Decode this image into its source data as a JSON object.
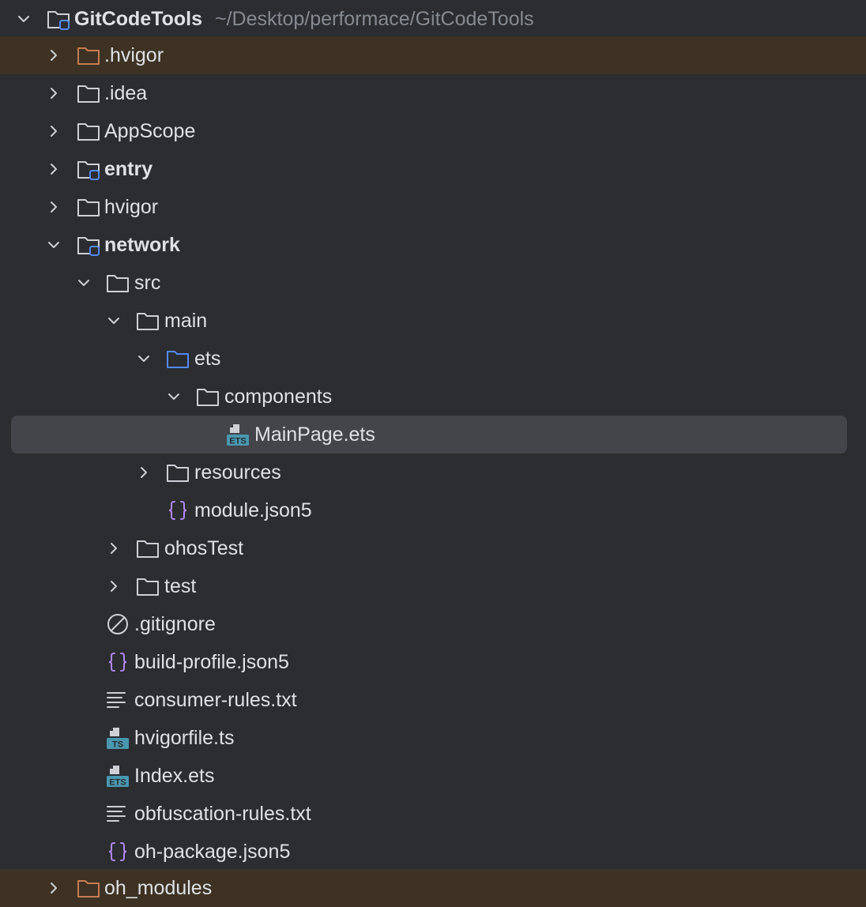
{
  "tree": {
    "root": {
      "label": "GitCodeTools",
      "path": "~/Desktop/performace/GitCodeTools",
      "icon": "module-folder-icon",
      "expanded": true
    },
    "items": [
      {
        "label": ".hvigor",
        "icon": "excluded-folder-icon",
        "expanded": false,
        "state": "excluded"
      },
      {
        "label": ".idea",
        "icon": "folder-icon",
        "expanded": false
      },
      {
        "label": "AppScope",
        "icon": "folder-icon",
        "expanded": false
      },
      {
        "label": "entry",
        "icon": "module-folder-icon",
        "expanded": false
      },
      {
        "label": "hvigor",
        "icon": "folder-icon",
        "expanded": false
      },
      {
        "label": "network",
        "icon": "module-folder-icon",
        "expanded": true
      },
      {
        "label": "src",
        "icon": "folder-icon",
        "expanded": true
      },
      {
        "label": "main",
        "icon": "folder-icon",
        "expanded": true
      },
      {
        "label": "ets",
        "icon": "source-folder-icon",
        "expanded": true
      },
      {
        "label": "components",
        "icon": "folder-icon",
        "expanded": true
      },
      {
        "label": "MainPage.ets",
        "icon": "ets-file-icon",
        "state": "selected",
        "badge": "ETS"
      },
      {
        "label": "resources",
        "icon": "folder-icon",
        "expanded": false
      },
      {
        "label": "module.json5",
        "icon": "json-file-icon"
      },
      {
        "label": "ohosTest",
        "icon": "folder-icon",
        "expanded": false
      },
      {
        "label": "test",
        "icon": "folder-icon",
        "expanded": false
      },
      {
        "label": ".gitignore",
        "icon": "ignore-file-icon"
      },
      {
        "label": "build-profile.json5",
        "icon": "json-file-icon"
      },
      {
        "label": "consumer-rules.txt",
        "icon": "text-file-icon"
      },
      {
        "label": "hvigorfile.ts",
        "icon": "ts-file-icon",
        "badge": "TS"
      },
      {
        "label": "Index.ets",
        "icon": "ets-file-icon",
        "badge": "ETS"
      },
      {
        "label": "obfuscation-rules.txt",
        "icon": "text-file-icon"
      },
      {
        "label": "oh-package.json5",
        "icon": "json-file-icon"
      },
      {
        "label": "oh_modules",
        "icon": "excluded-folder-icon",
        "expanded": false,
        "state": "excluded"
      }
    ]
  },
  "colors": {
    "background": "#2b2d30",
    "text": "#dfe1e5",
    "path_text": "#868a91",
    "selection": "#43454a",
    "excluded_row": "#3d3223",
    "excluded_folder": "#c77d55",
    "module_marker": "#548af7",
    "json_icon": "#b189f5",
    "file_badge": "#4a97b0"
  }
}
